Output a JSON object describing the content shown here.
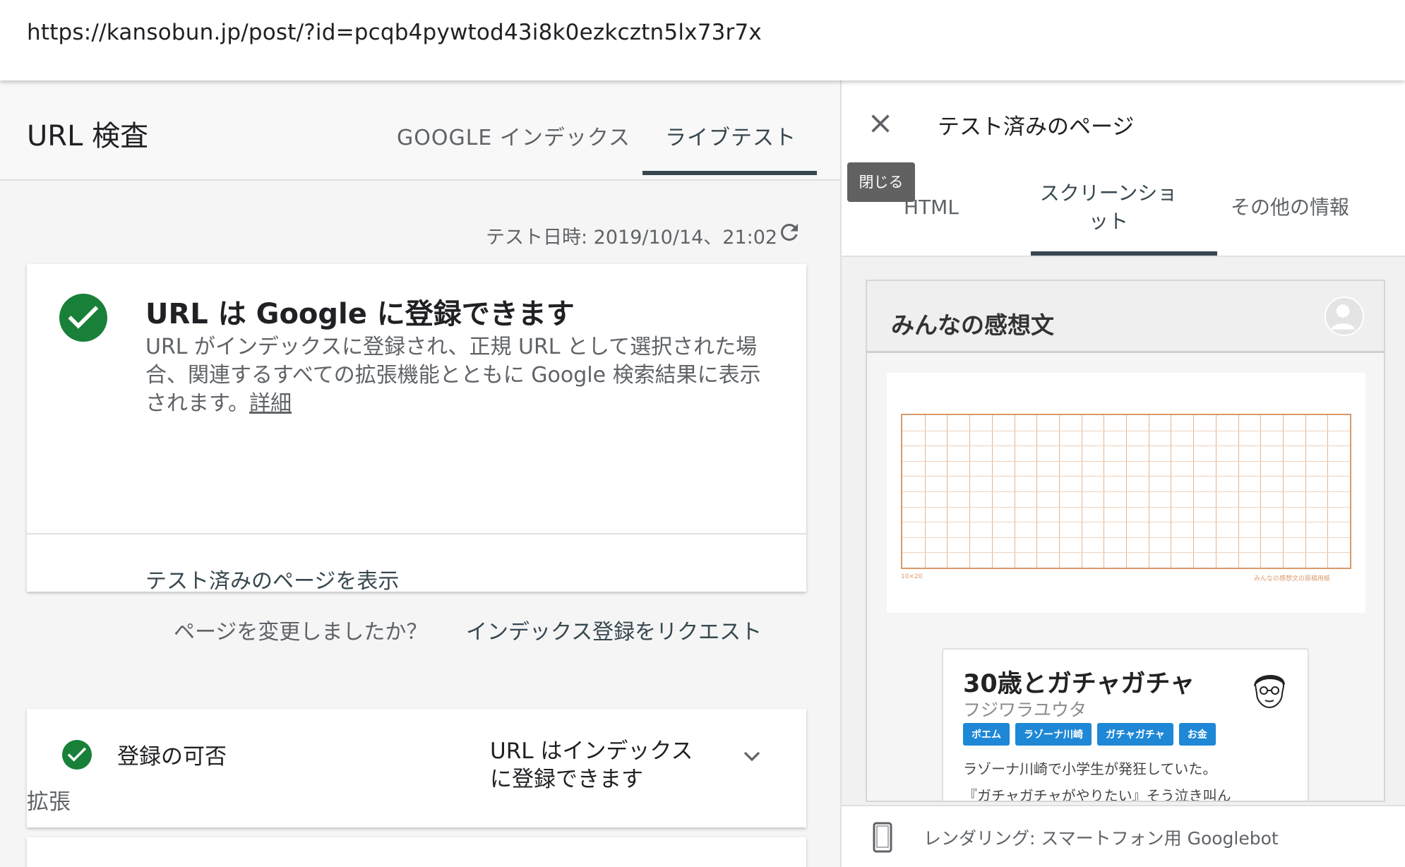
{
  "url_bar": {
    "url": "https://kansobun.jp/post/?id=pcqb4pywtod43i8k0ezkcztn5lx73r7x"
  },
  "left": {
    "title": "URL 検査",
    "tabs": [
      {
        "label": "GOOGLE インデックス",
        "active": false
      },
      {
        "label": "ライブテスト",
        "active": true
      }
    ],
    "test_date": "テスト日時: 2019/10/14、21:02",
    "result_card": {
      "heading": "URL は Google に登録できます",
      "description": "URL がインデックスに登録され、正規 URL として選択された場合、関連するすべての拡張機能とともに Google 検索結果に表示されます。",
      "details_link": "詳細",
      "view_tested_page": "テスト済みのページを表示",
      "changed_question": "ページを変更しましたか？",
      "request_indexing": "インデックス登録をリクエスト"
    },
    "status_card": {
      "label": "登録の可否",
      "value_line1": "URL はインデックス",
      "value_line2": "に登録できます"
    },
    "extensions_label": "拡張"
  },
  "right": {
    "title": "テスト済みのページ",
    "close_tooltip": "閉じる",
    "tabs": [
      {
        "label": "HTML",
        "active": false
      },
      {
        "label_line1": "スクリーンショ",
        "label_line2": "ット",
        "active": true
      },
      {
        "label": "その他の情報",
        "active": false
      }
    ],
    "screenshot": {
      "site_title": "みんなの感想文",
      "genkou_left": "10×20",
      "genkou_right": "みんなの感想文の原稿用紙",
      "article": {
        "title": "30歳とガチャガチャ",
        "author": "フジワラユウタ",
        "tags": [
          "ポエム",
          "ラゾーナ川崎",
          "ガチャガチャ",
          "お金"
        ],
        "excerpt_line1": "ラゾーナ川崎で小学生が発狂していた。",
        "excerpt_line2": "『ガチャガチャがやりたい』そう泣き叫ん"
      }
    },
    "footer": {
      "render_text": "レンダリング: スマートフォン用 Googlebot"
    }
  },
  "colors": {
    "success_green": "#188038",
    "tab_active": "#37474f",
    "tag_blue": "#1e88d6",
    "genkou_orange": "#d99a6c"
  }
}
